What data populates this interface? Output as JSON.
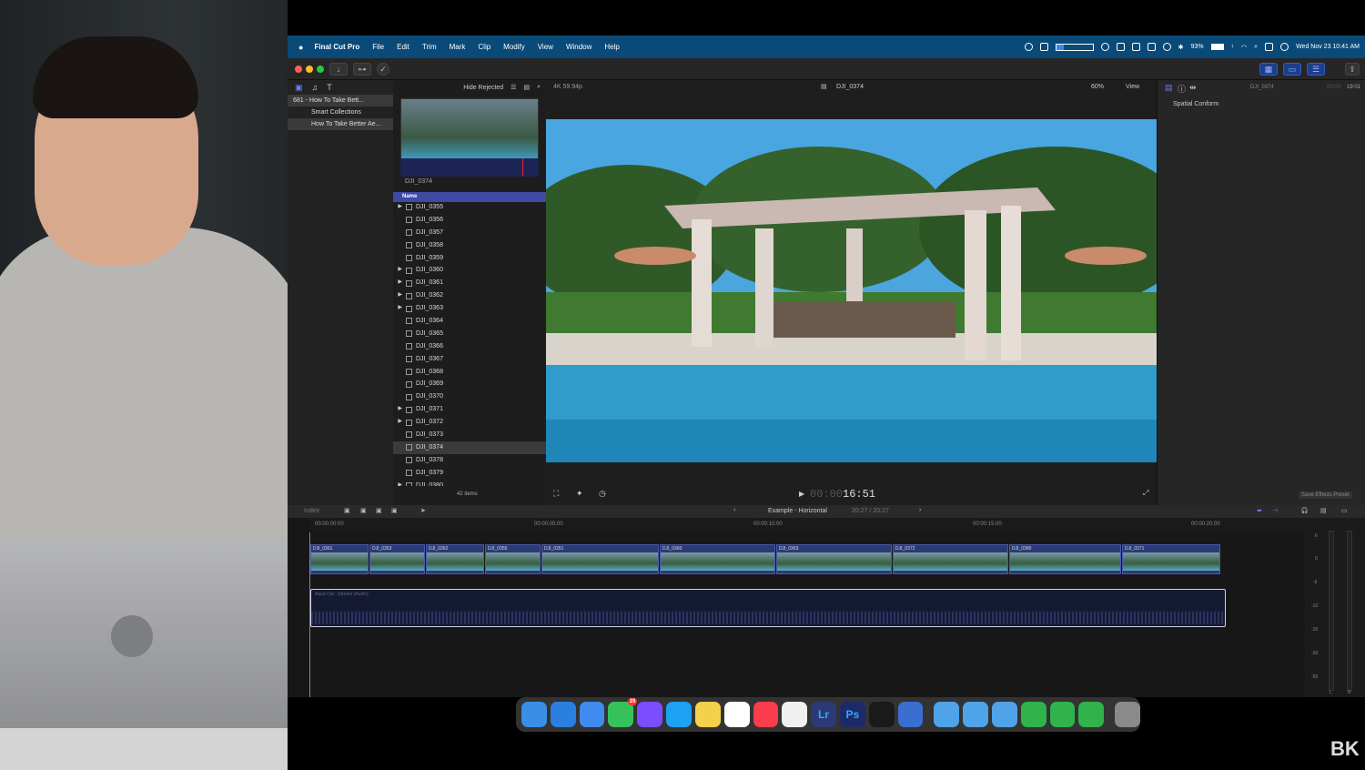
{
  "menubar": {
    "apple": "",
    "app_name": "Final Cut Pro",
    "items": [
      "File",
      "Edit",
      "Trim",
      "Mark",
      "Clip",
      "Modify",
      "View",
      "Window",
      "Help"
    ],
    "battery": "93%",
    "datetime": "Wed Nov 23  10:41 AM"
  },
  "library": {
    "rows": [
      {
        "label": "681 - How To Take Bett..."
      },
      {
        "label": "Smart Collections"
      },
      {
        "label": "How To Take Better Ae..."
      }
    ]
  },
  "browser": {
    "filter": "Hide Rejected",
    "thumb_label": "DJI_0374",
    "column_header": "Name",
    "clips": [
      {
        "name": "DJI_0355",
        "expand": true
      },
      {
        "name": "DJI_0356",
        "expand": false
      },
      {
        "name": "DJI_0357",
        "expand": false
      },
      {
        "name": "DJI_0358",
        "expand": false
      },
      {
        "name": "DJI_0359",
        "expand": false
      },
      {
        "name": "DJI_0360",
        "expand": true
      },
      {
        "name": "DJI_0361",
        "expand": true
      },
      {
        "name": "DJI_0362",
        "expand": true
      },
      {
        "name": "DJI_0363",
        "expand": true
      },
      {
        "name": "DJI_0364",
        "expand": false
      },
      {
        "name": "DJI_0365",
        "expand": false
      },
      {
        "name": "DJI_0366",
        "expand": false
      },
      {
        "name": "DJI_0367",
        "expand": false
      },
      {
        "name": "DJI_0368",
        "expand": false
      },
      {
        "name": "DJI_0369",
        "expand": false
      },
      {
        "name": "DJI_0370",
        "expand": false
      },
      {
        "name": "DJI_0371",
        "expand": true
      },
      {
        "name": "DJI_0372",
        "expand": true
      },
      {
        "name": "DJI_0373",
        "expand": false
      },
      {
        "name": "DJI_0374",
        "expand": false,
        "selected": true
      },
      {
        "name": "DJI_0378",
        "expand": false
      },
      {
        "name": "DJI_0379",
        "expand": false
      },
      {
        "name": "DJI_0380",
        "expand": true
      }
    ],
    "item_count": "42 items"
  },
  "viewer": {
    "format": "4K 59.94p",
    "clip_name": "DJI_0374",
    "zoom": "60%",
    "view_label": "View",
    "timecode_dim": "00:00:",
    "timecode": "16:51"
  },
  "inspector": {
    "clip_name": "DJI_0374",
    "duration": "19:01",
    "duration_dim": "00:00:",
    "field_label": "Spatial Conform",
    "save_preset": "Save Effects Preset"
  },
  "timeline": {
    "index_label": "Index",
    "project_name": "Example - Horizontal",
    "project_time": "20:27 / 20:27",
    "ruler": [
      "00:00:00:00",
      "00:00:05:00",
      "00:00:10:00",
      "00:00:15:00",
      "00:00:20:00"
    ],
    "clips": [
      "DJI_0361",
      "DJI_0353",
      "DJI_0362",
      "DJI_0355",
      "DJI_0351",
      "DJI_0360",
      "DJI_0363",
      "DJI_0372",
      "DJI_0380",
      "DJI_0371"
    ],
    "audio_label": "Aqua Cat - Streets (Audio)",
    "meter_scale": [
      "6",
      "0",
      "-6",
      "-12",
      "-20",
      "-30",
      "-50"
    ],
    "meter_channels": [
      "L",
      "R"
    ]
  },
  "dock": {
    "apps": [
      "Finder",
      "Safari",
      "Mail",
      "Messages",
      "Messenger",
      "Twitter",
      "Notes",
      "Calendar",
      "Music",
      "Photos",
      "Lr",
      "Ps",
      "Final Cut Pro",
      "QuickTime",
      "Applications",
      "Documents",
      "Downloads",
      "Numbers",
      "Numbers",
      "Numbers",
      "Trash"
    ],
    "messages_badge": "19"
  },
  "colors": {
    "menubar": "#0a4a78",
    "accent": "#4a5ab8",
    "selection": "#3f4aa5"
  }
}
